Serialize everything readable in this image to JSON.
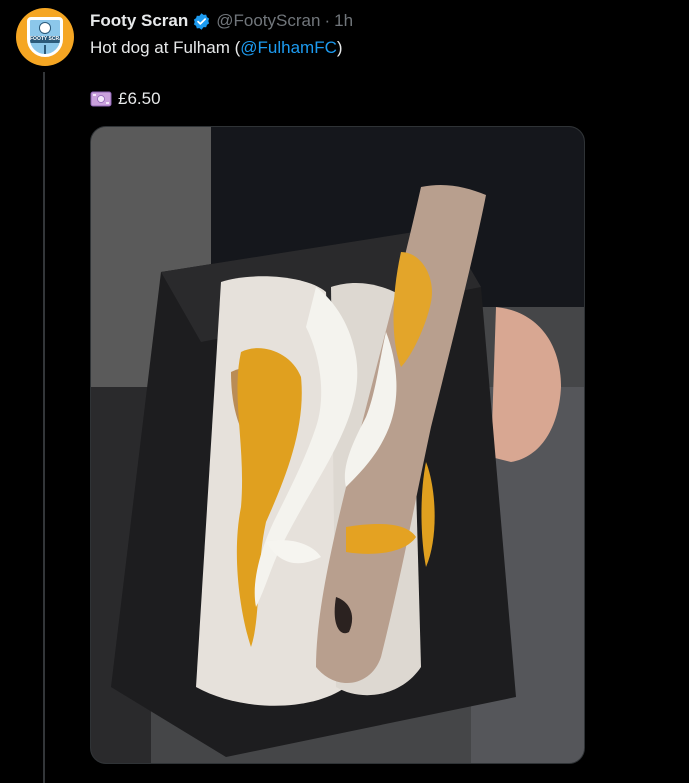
{
  "tweet": {
    "display_name": "Footy Scran",
    "handle": "@FootyScran",
    "separator": "·",
    "time": "1h",
    "text_before": "Hot dog at Fulham (",
    "mention": "@FulhamFC",
    "text_after": ")",
    "price": "£6.50"
  },
  "avatar": {
    "band_text": "FOOTY SCRAN"
  },
  "icons": {
    "verified": "verified-badge-icon",
    "money": "money-banknote-icon"
  },
  "colors": {
    "background": "#000000",
    "text": "#e7e9ea",
    "muted": "#71767b",
    "link": "#1d9bf0",
    "avatar_bg": "#f5a623"
  }
}
